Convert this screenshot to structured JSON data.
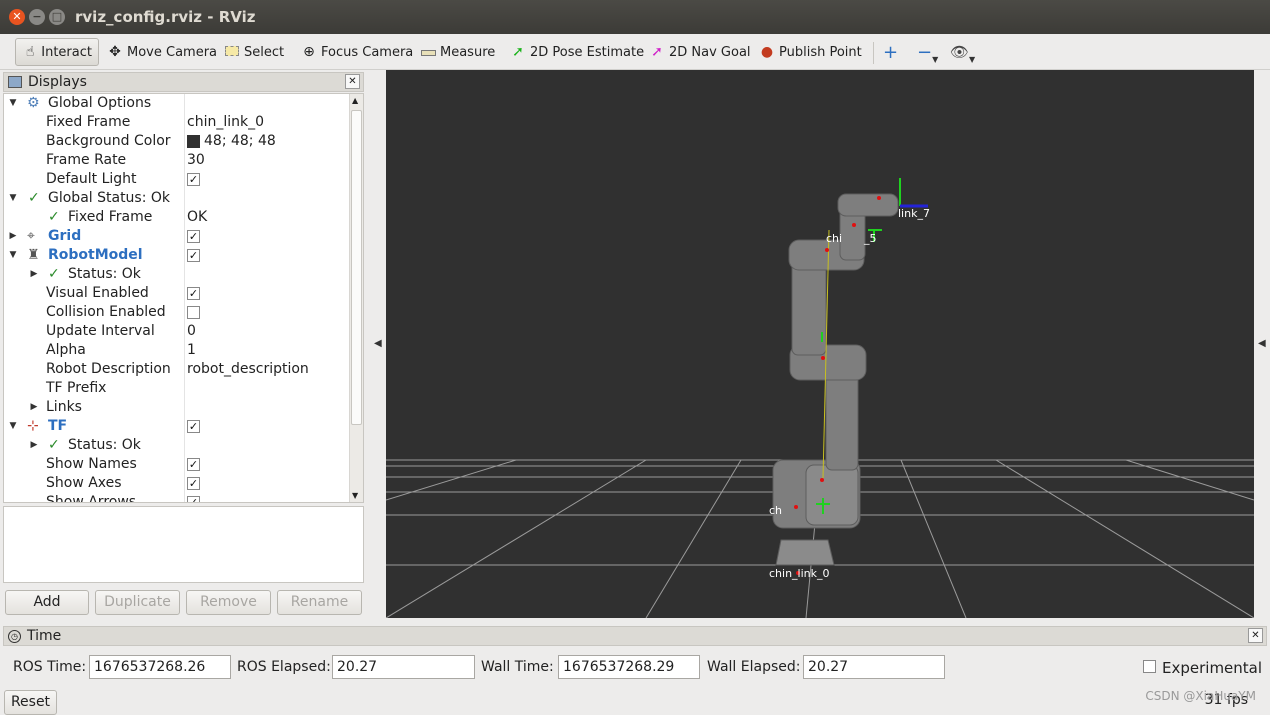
{
  "window": {
    "title": "rviz_config.rviz - RViz"
  },
  "toolbar": {
    "interact": "Interact",
    "move_camera": "Move Camera",
    "select": "Select",
    "focus_camera": "Focus Camera",
    "measure": "Measure",
    "pose_estimate": "2D Pose Estimate",
    "nav_goal": "2D Nav Goal",
    "publish_point": "Publish Point"
  },
  "displays": {
    "title": "Displays",
    "rows": [
      {
        "label": "Global Options",
        "value": ""
      },
      {
        "label": "Fixed Frame",
        "value": "chin_link_0"
      },
      {
        "label": "Background Color",
        "value": "48; 48; 48"
      },
      {
        "label": "Frame Rate",
        "value": "30"
      },
      {
        "label": "Default Light",
        "value": "✓"
      },
      {
        "label": "Global Status: Ok",
        "value": ""
      },
      {
        "label": "Fixed Frame",
        "value": "OK"
      },
      {
        "label": "Grid",
        "value": "✓"
      },
      {
        "label": "RobotModel",
        "value": "✓"
      },
      {
        "label": "Status: Ok",
        "value": ""
      },
      {
        "label": "Visual Enabled",
        "value": "✓"
      },
      {
        "label": "Collision Enabled",
        "value": ""
      },
      {
        "label": "Update Interval",
        "value": "0"
      },
      {
        "label": "Alpha",
        "value": "1"
      },
      {
        "label": "Robot Description",
        "value": "robot_description"
      },
      {
        "label": "TF Prefix",
        "value": ""
      },
      {
        "label": "Links",
        "value": ""
      },
      {
        "label": "TF",
        "value": "✓"
      },
      {
        "label": "Status: Ok",
        "value": ""
      },
      {
        "label": "Show Names",
        "value": "✓"
      },
      {
        "label": "Show Axes",
        "value": "✓"
      },
      {
        "label": "Show Arrows",
        "value": "✓"
      }
    ],
    "buttons": {
      "add": "Add",
      "duplicate": "Duplicate",
      "remove": "Remove",
      "rename": "Rename"
    }
  },
  "viewport": {
    "frame_labels": {
      "link7": "link_7",
      "link5": "chi",
      "link5b": "_5",
      "link1": "ch",
      "link0": "chin_link_0"
    },
    "background": "#303030"
  },
  "time": {
    "title": "Time",
    "ros_time_label": "ROS Time:",
    "ros_time": "1676537268.26",
    "ros_elapsed_label": "ROS Elapsed:",
    "ros_elapsed": "20.27",
    "wall_time_label": "Wall Time:",
    "wall_time": "1676537268.29",
    "wall_elapsed_label": "Wall Elapsed:",
    "wall_elapsed": "20.27",
    "experimental_label": "Experimental",
    "reset_label": "Reset",
    "fps": "31 fps",
    "watermark": "CSDN @XiaHuaYM"
  }
}
